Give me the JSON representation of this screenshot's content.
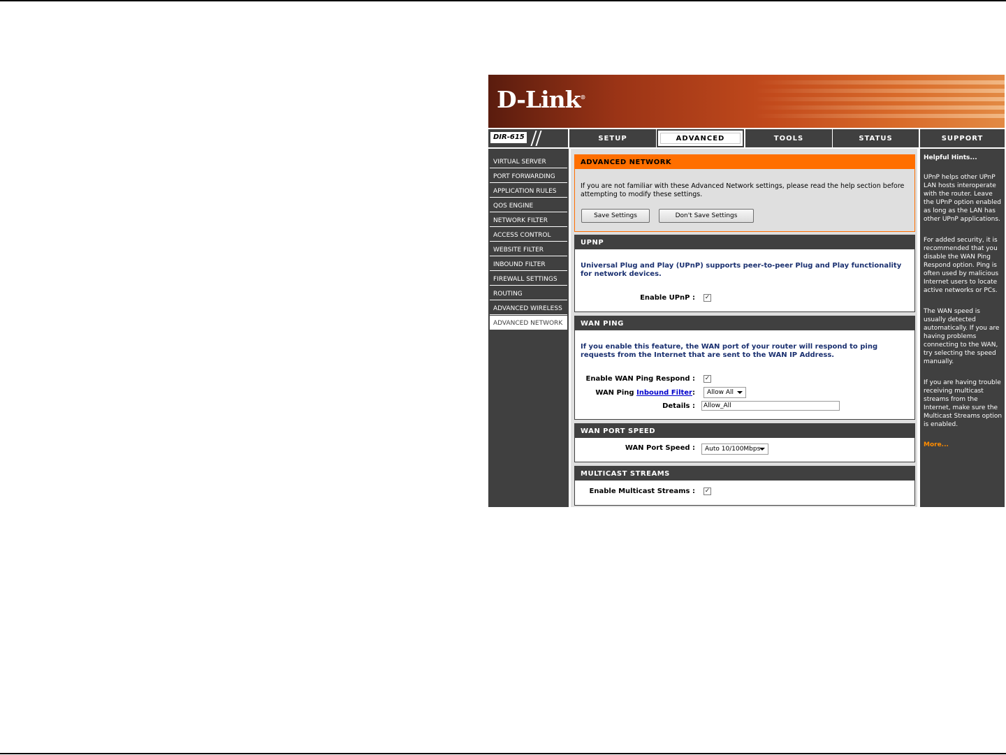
{
  "brand": {
    "logo_text": "D-Link",
    "trademark": "®",
    "model": "DIR-615"
  },
  "topnav": {
    "tabs": [
      "SETUP",
      "ADVANCED",
      "TOOLS",
      "STATUS",
      "SUPPORT"
    ],
    "active": "ADVANCED"
  },
  "sidebar": {
    "items": [
      "VIRTUAL SERVER",
      "PORT FORWARDING",
      "APPLICATION RULES",
      "QOS ENGINE",
      "NETWORK FILTER",
      "ACCESS CONTROL",
      "WEBSITE FILTER",
      "INBOUND FILTER",
      "FIREWALL SETTINGS",
      "ROUTING",
      "ADVANCED WIRELESS",
      "ADVANCED NETWORK"
    ],
    "active": "ADVANCED NETWORK"
  },
  "advanced_network": {
    "title": "ADVANCED NETWORK",
    "intro": "If you are not familiar with these Advanced Network settings, please read the help section before attempting to modify these settings.",
    "save_label": "Save Settings",
    "dont_save_label": "Don't Save Settings"
  },
  "upnp": {
    "title": "UPNP",
    "desc": "Universal Plug and Play (UPnP) supports peer-to-peer Plug and Play functionality for network devices.",
    "enable_label": "Enable UPnP :",
    "enabled": true
  },
  "wan_ping": {
    "title": "WAN PING",
    "desc": "If you enable this feature, the WAN port of your router will respond to ping requests from the Internet that are sent to the WAN IP Address.",
    "respond_label": "Enable WAN Ping Respond :",
    "respond_enabled": true,
    "filter_label_prefix": "WAN Ping",
    "filter_link": "Inbound Filter",
    "filter_label_suffix": ":",
    "filter_value": "Allow All",
    "details_label": "Details :",
    "details_value": "Allow_All"
  },
  "wan_port_speed": {
    "title": "WAN PORT SPEED",
    "label": "WAN Port Speed :",
    "value": "Auto 10/100Mbps"
  },
  "multicast": {
    "title": "MULTICAST STREAMS",
    "label": "Enable Multicast Streams :",
    "enabled": true
  },
  "hints": {
    "title": "Helpful Hints...",
    "items": [
      "UPnP helps other UPnP LAN hosts interoperate with the router. Leave the UPnP option enabled as long as the LAN has other UPnP applications.",
      "For added security, it is recommended that you disable the WAN Ping Respond option. Ping is often used by malicious Internet users to locate active networks or PCs.",
      "The WAN speed is usually detected automatically. If you are having problems connecting to the WAN, try selecting the speed manually.",
      "If you are having trouble receiving multicast streams from the Internet, make sure the Multicast Streams option is enabled."
    ],
    "more_label": "More..."
  },
  "colors": {
    "accent": "#ff6f00",
    "panel_dark": "#404040",
    "content_bg": "#dfdfdf",
    "desc_text": "#1a3070"
  },
  "checkmark": "✓"
}
